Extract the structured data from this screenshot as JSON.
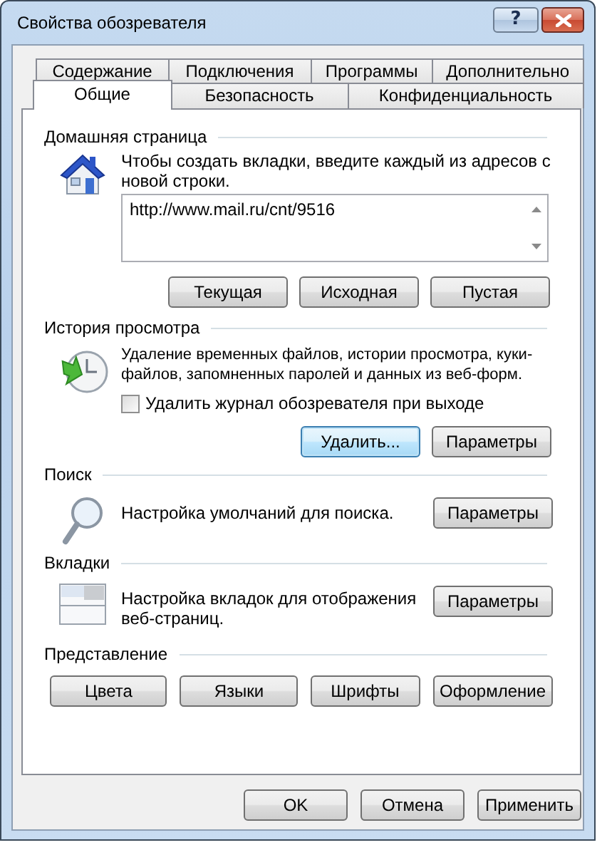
{
  "window": {
    "title": "Свойства обозревателя",
    "help": "?"
  },
  "tab_rows": [
    {
      "tabs": [
        {
          "label": "Содержание",
          "selected": false
        },
        {
          "label": "Подключения",
          "selected": false
        },
        {
          "label": "Программы",
          "selected": false
        },
        {
          "label": "Дополнительно",
          "selected": false
        }
      ]
    },
    {
      "tabs": [
        {
          "label": "Общие",
          "selected": true
        },
        {
          "label": "Безопасность",
          "selected": false
        },
        {
          "label": "Конфиденциальность",
          "selected": false
        }
      ]
    }
  ],
  "sections": [
    {
      "kind": "home",
      "heading": "Домашняя страница",
      "description": "Чтобы создать вкладки, введите каждый из адресов с новой строки.",
      "urls": "http://www.mail.ru/cnt/9516",
      "buttons": [
        {
          "label": "Текущая",
          "focused": false
        },
        {
          "label": "Исходная",
          "focused": false
        },
        {
          "label": "Пустая",
          "focused": false
        }
      ]
    },
    {
      "kind": "history",
      "heading": "История просмотра",
      "description": "Удаление временных файлов, истории просмотра, куки-файлов, запомненных паролей и данных из веб-форм.",
      "checkbox": {
        "label": "Удалить журнал обозревателя при выходе",
        "checked": false
      },
      "buttons": [
        {
          "label": "Удалить...",
          "focused": true
        },
        {
          "label": "Параметры",
          "focused": false
        }
      ]
    },
    {
      "kind": "search",
      "heading": "Поиск",
      "description": "Настройка умолчаний для поиска.",
      "buttons": [
        {
          "label": "Параметры",
          "focused": false
        }
      ]
    },
    {
      "kind": "tabs",
      "heading": "Вкладки",
      "description": "Настройка вкладок для отображения веб-страниц.",
      "buttons": [
        {
          "label": "Параметры",
          "focused": false
        }
      ]
    },
    {
      "kind": "appearance",
      "heading": "Представление",
      "buttons": [
        {
          "label": "Цвета",
          "focused": false
        },
        {
          "label": "Языки",
          "focused": false
        },
        {
          "label": "Шрифты",
          "focused": false
        },
        {
          "label": "Оформление",
          "focused": false
        }
      ]
    }
  ],
  "footer_buttons": [
    {
      "label": "OK",
      "focused": false
    },
    {
      "label": "Отмена",
      "focused": false
    },
    {
      "label": "Применить",
      "focused": false
    }
  ]
}
